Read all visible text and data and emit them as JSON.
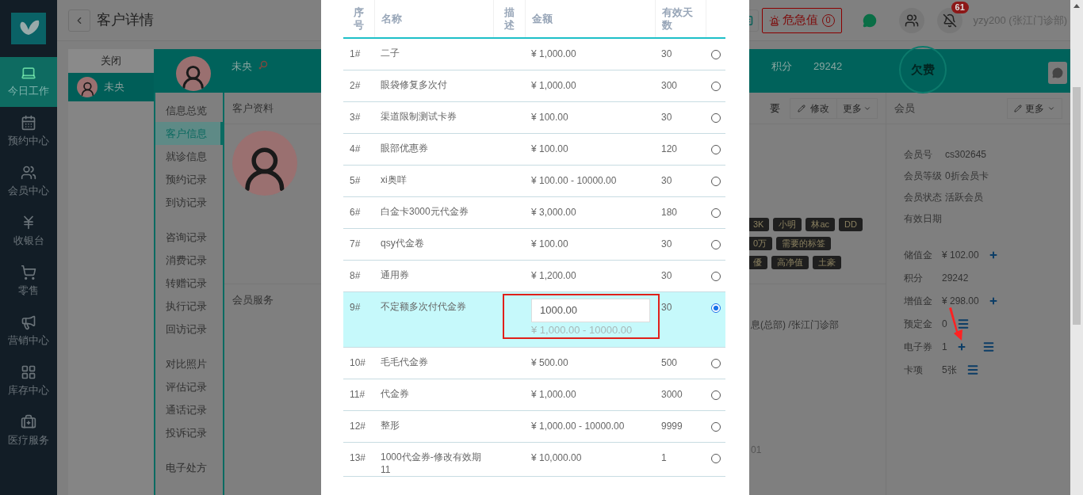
{
  "nav": {
    "items": [
      {
        "label": "今日工作",
        "kind": "laptop",
        "selected": true
      },
      {
        "label": "预约中心",
        "kind": "calendar",
        "selected": false
      },
      {
        "label": "会员中心",
        "kind": "users",
        "selected": false
      },
      {
        "label": "收银台",
        "kind": "yen",
        "selected": false
      },
      {
        "label": "零售",
        "kind": "cart",
        "selected": false
      },
      {
        "label": "营销中心",
        "kind": "megaphone",
        "selected": false
      },
      {
        "label": "库存中心",
        "kind": "grid",
        "selected": false
      },
      {
        "label": "医疗服务",
        "kind": "medkit",
        "selected": false
      }
    ]
  },
  "top_bar": {
    "title": "客户详情",
    "alert_button": "危急值",
    "alert_count": "0",
    "notification_count": "61",
    "user": "yzy200 (张江门诊部)"
  },
  "customer_tabs": {
    "close": "关闭",
    "items": [
      {
        "name": "未央",
        "selected": true
      }
    ]
  },
  "profile_header": {
    "name": "未央",
    "points_label": "积分",
    "points": "29242",
    "stamp": "欠费"
  },
  "side_menu": {
    "groups": [
      [
        {
          "label": "信息总览",
          "selected": false
        },
        {
          "label": "客户信息",
          "selected": true
        },
        {
          "label": "就诊信息",
          "selected": false
        },
        {
          "label": "预约记录",
          "selected": false
        },
        {
          "label": "到访记录",
          "selected": false
        }
      ],
      [
        {
          "label": "咨询记录",
          "selected": false
        },
        {
          "label": "消费记录",
          "selected": false
        },
        {
          "label": "转赠记录",
          "selected": false
        },
        {
          "label": "执行记录",
          "selected": false
        },
        {
          "label": "回访记录",
          "selected": false
        }
      ],
      [
        {
          "label": "对比照片",
          "selected": false
        },
        {
          "label": "评估记录",
          "selected": false
        },
        {
          "label": "通话记录",
          "selected": false
        },
        {
          "label": "投诉记录",
          "selected": false
        }
      ],
      [
        {
          "label": "电子处方",
          "selected": false
        }
      ]
    ]
  },
  "profile": {
    "section_title": "客户资料",
    "summary_title": "要",
    "edit_button": "修改",
    "more_button": "更多",
    "tag_rows": [
      [
        "3K",
        "小明",
        "林ac",
        "DD"
      ],
      [
        "0万",
        "需要的标签"
      ],
      [
        "優",
        "高净值",
        "土豪"
      ]
    ],
    "member_service_label": "会员服务",
    "org_text": "息(总部)  /张江门诊部",
    "partial_number": "01"
  },
  "member": {
    "title": "会员",
    "more_button": "更多",
    "info": [
      {
        "label": "会员号",
        "value": "cs302645"
      },
      {
        "label": "会员等级",
        "value": "0折会员卡"
      },
      {
        "label": "会员状态",
        "value": "活跃会员"
      },
      {
        "label": "有效日期"
      }
    ],
    "balances": [
      {
        "label": "储值金",
        "value": "¥ 102.00",
        "add": true,
        "details": false
      },
      {
        "label": "积分",
        "value": "29242",
        "add": false,
        "details": false
      },
      {
        "label": "增值金",
        "value": "¥ 298.00",
        "add": true,
        "details": false
      },
      {
        "label": "预定金",
        "value": "0",
        "add": false,
        "details": true
      },
      {
        "label": "电子券",
        "value": "1",
        "add": true,
        "details": true
      },
      {
        "label": "卡项",
        "value": "5张",
        "add": false,
        "details": true
      }
    ]
  },
  "modal": {
    "columns": [
      "序号",
      "名称",
      "描述",
      "金额",
      "有效天数"
    ],
    "rows": [
      {
        "no": "1#",
        "name": "二子",
        "amount": "¥ 1,000.00",
        "days": "30",
        "selected": false
      },
      {
        "no": "2#",
        "name": "眼袋修复多次付",
        "amount": "¥ 1,000.00",
        "days": "300",
        "selected": false
      },
      {
        "no": "3#",
        "name": "渠道限制测试卡券",
        "amount": "¥ 100.00",
        "days": "30",
        "selected": false
      },
      {
        "no": "4#",
        "name": "眼部优惠券",
        "amount": "¥ 100.00",
        "days": "120",
        "selected": false
      },
      {
        "no": "5#",
        "name": "xi奥咩",
        "amount": "¥ 100.00 - 10000.00",
        "days": "30",
        "selected": false
      },
      {
        "no": "6#",
        "name": "白金卡3000元代金券",
        "amount": "¥ 3,000.00",
        "days": "180",
        "selected": false
      },
      {
        "no": "7#",
        "name": "qsy代金卷",
        "amount": "¥ 100.00",
        "days": "30",
        "selected": false
      },
      {
        "no": "8#",
        "name": "通用券",
        "amount": "¥ 1,200.00",
        "days": "30",
        "selected": false
      },
      {
        "no": "9#",
        "name": "不定额多次付代金券",
        "amount": "¥ 1,000.00 - 10000.00",
        "amount_input": "1000.00",
        "days": "30",
        "selected": true
      },
      {
        "no": "10#",
        "name": "毛毛代金券",
        "amount": "¥ 500.00",
        "days": "500",
        "selected": false
      },
      {
        "no": "11#",
        "name": "代金券",
        "amount": "¥ 1,000.00",
        "days": "3000",
        "selected": false
      },
      {
        "no": "12#",
        "name": "整形",
        "amount": "¥ 1,000.00 - 10000.00",
        "days": "9999",
        "selected": false
      },
      {
        "no": "13#",
        "name": "1000代金券-修改有效期11",
        "amount": "¥ 10,000.00",
        "days": "1",
        "selected": false
      }
    ]
  }
}
